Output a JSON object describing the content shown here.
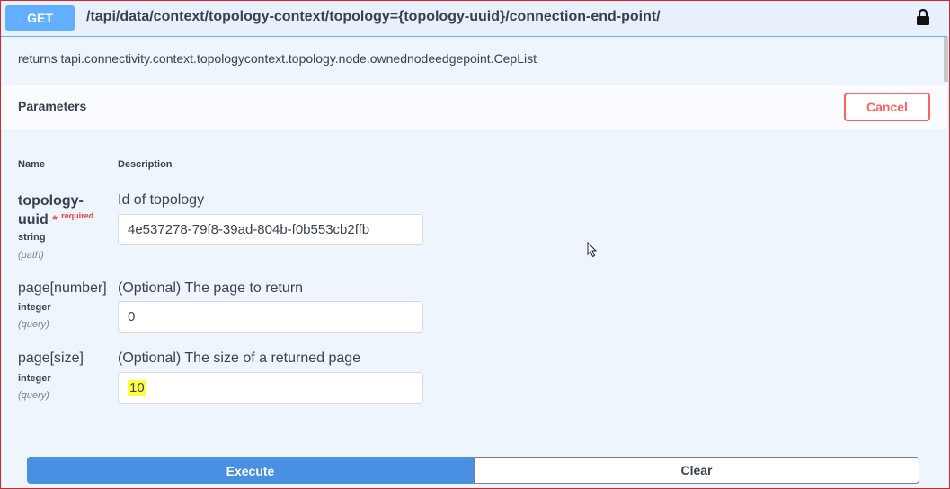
{
  "operation": {
    "method": "GET",
    "path": "/tapi/data/context/topology-context/topology={topology-uuid}/connection-end-point/",
    "summary": "returns tapi.connectivity.context.topologycontext.topology.node.ownednodeedgepoint.CepList",
    "lock_icon": "lock-icon"
  },
  "parameters_section": {
    "title": "Parameters",
    "cancel_label": "Cancel"
  },
  "table": {
    "col_name": "Name",
    "col_description": "Description"
  },
  "params": [
    {
      "name_line1": "topology-",
      "name_line2": "uuid",
      "required_star": "*",
      "required_label": "required",
      "type": "string",
      "in": "(path)",
      "description": "Id of topology",
      "value": "4e537278-79f8-39ad-804b-f0b553cb2ffb"
    },
    {
      "name": "page[number]",
      "type": "integer",
      "in": "(query)",
      "description": "(Optional) The page to return",
      "value": "0"
    },
    {
      "name": "page[size]",
      "type": "integer",
      "in": "(query)",
      "description": "(Optional) The size of a returned page",
      "value": "10"
    }
  ],
  "actions": {
    "execute_label": "Execute",
    "clear_label": "Clear"
  },
  "colors": {
    "method_bg": "#61affe",
    "cancel": "#ff6060",
    "execute_bg": "#4990e2",
    "highlight": "#ffff40"
  }
}
